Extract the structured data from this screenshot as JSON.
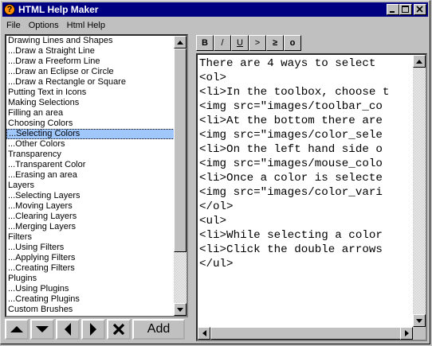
{
  "window": {
    "title": "HTML Help Maker",
    "app_icon": "?",
    "minimize_icon": "minimize-icon",
    "maximize_icon": "maximize-icon",
    "close_icon": "close-icon"
  },
  "menu": [
    "File",
    "Options",
    "Html Help"
  ],
  "topics": [
    "Drawing Lines and Shapes",
    "...Draw a Straight Line",
    "...Draw a Freeform Line",
    "...Draw an Eclipse or Circle",
    "...Draw a Rectangle or Square",
    "Putting Text in Icons",
    "Making Selections",
    "Filling an area",
    "Choosing Colors",
    "...Selecting Colors",
    "...Other Colors",
    "Transparency",
    "...Transparent Color",
    "...Erasing an area",
    "Layers",
    "...Selecting Layers",
    "...Moving Layers",
    "...Clearing Layers",
    "...Merging Layers",
    "Filters",
    "...Using Filters",
    "...Applying Filters",
    "...Creating Filters",
    "Plugins",
    "...Using Plugins",
    "...Creating Plugins",
    "Custom Brushes"
  ],
  "selected_topic_index": 9,
  "nav_buttons": {
    "up": "move-up-icon",
    "down": "move-down-icon",
    "left": "move-left-icon",
    "right": "move-right-icon",
    "delete": "delete-icon",
    "add_label": "Add"
  },
  "format_toolbar": [
    "B",
    "/",
    "U",
    ">",
    "≥",
    "o"
  ],
  "editor_lines": [
    "There are 4 ways to select",
    "<ol>",
    "<li>In the toolbox, choose t",
    "<img src=\"images/toolbar_co",
    "<li>At the bottom there are",
    "<img src=\"images/color_sele",
    "<li>On the left hand side o",
    "<img src=\"images/mouse_colo",
    "<li>Once a color is selecte",
    "<img src=\"images/color_vari",
    "</ol>",
    "<ul>",
    "<li>While selecting a color",
    "<li>Click the double arrows",
    "</ul>"
  ]
}
